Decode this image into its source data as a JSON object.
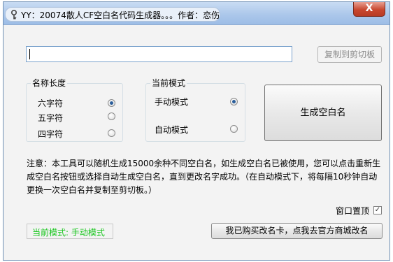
{
  "window": {
    "title": "YY：20074散人CF空白名代码生成器。。。作者：恋伤",
    "close_label": "X"
  },
  "output": {
    "value": "",
    "copy_label": "复制到剪切板"
  },
  "length_group": {
    "legend": "名称长度",
    "options": [
      {
        "label": "六字符",
        "checked": true
      },
      {
        "label": "五字符",
        "checked": false
      },
      {
        "label": "四字符",
        "checked": false
      }
    ]
  },
  "mode_group": {
    "legend": "当前模式",
    "options": [
      {
        "label": "手动模式",
        "checked": true
      },
      {
        "label": "自动模式",
        "checked": false
      }
    ]
  },
  "generate_label": "生成空白名",
  "note": "注意：本工具可以随机生成15000余种不同空白名，如生成空白名已被使用，您可以点击重新生成空白名按钮或选择自动生成空白名，直到更改名字成功。（在自动模式下，将每隔10秒钟自动更换一次空白名并复制至剪切板。）",
  "topmost": {
    "label": "窗口置顶",
    "checked": true
  },
  "status": {
    "text": "当前模式: 手动模式",
    "color": "#19c61e"
  },
  "buy_label": "我已购买改名卡，点我去官方商城改名"
}
